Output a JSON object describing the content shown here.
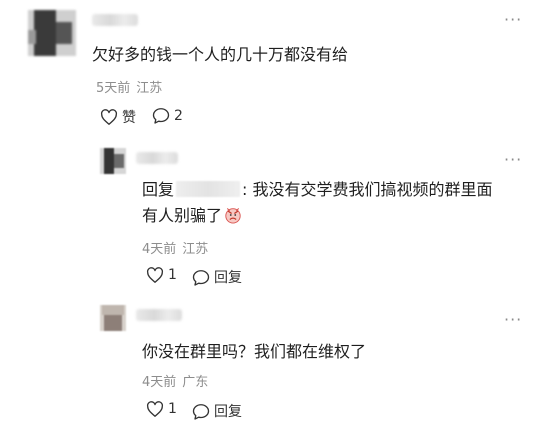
{
  "comments": [
    {
      "text": "欠好多的钱一个人的几十万都没有给",
      "date": "5天前",
      "location": "江苏",
      "like_label": "赞",
      "reply_count": "2"
    },
    {
      "reply_prefix": "回复",
      "text_after_name": ": 我没有交学费我们搞视频的群里面",
      "text_line2": "有人别骗了",
      "date": "4天前",
      "location": "江苏",
      "like_count": "1",
      "reply_label": "回复"
    },
    {
      "text": "你没在群里吗？我们都在维权了",
      "date": "4天前",
      "location": "广东",
      "like_count": "1",
      "reply_label": "回复"
    }
  ],
  "icons": {
    "more": "more-dots-icon",
    "heart": "heart-outline-icon",
    "comment": "comment-bubble-icon",
    "emoji": "angry-face-emoji-icon"
  }
}
